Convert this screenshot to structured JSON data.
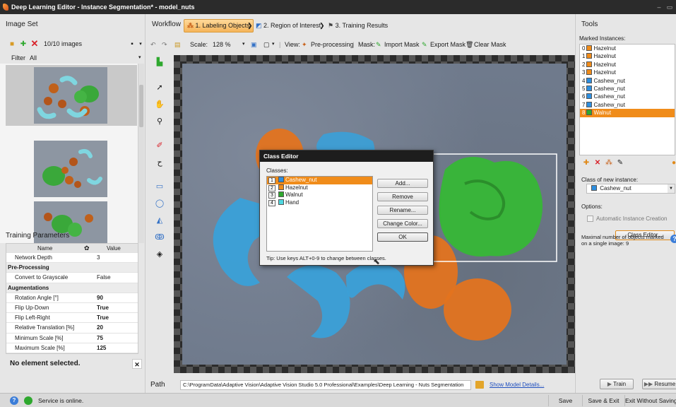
{
  "window": {
    "title": "Deep Learning Editor - Instance Segmentation* - model_nuts"
  },
  "image_set": {
    "header": "Image Set",
    "count_label": "10/10 images",
    "filter_label": "Filter",
    "filter_value": "All"
  },
  "training_params": {
    "header": "Training Parameters",
    "col_name": "Name",
    "col_value": "Value",
    "rows": [
      {
        "name": "Network Depth",
        "value": "3",
        "section": false,
        "bold": false
      },
      {
        "name": "Pre-Processing",
        "value": "",
        "section": true,
        "bold": false
      },
      {
        "name": "Convert to Grayscale",
        "value": "False",
        "section": false,
        "bold": false
      },
      {
        "name": "Augmentations",
        "value": "",
        "section": true,
        "bold": false
      },
      {
        "name": "Rotation Angle [°]",
        "value": "90",
        "section": false,
        "bold": true
      },
      {
        "name": "Flip Up-Down",
        "value": "True",
        "section": false,
        "bold": true
      },
      {
        "name": "Flip Left-Right",
        "value": "True",
        "section": false,
        "bold": true
      },
      {
        "name": "Relative Translation [%]",
        "value": "20",
        "section": false,
        "bold": true
      },
      {
        "name": "Minimum Scale [%]",
        "value": "75",
        "section": false,
        "bold": true
      },
      {
        "name": "Maximum Scale [%]",
        "value": "125",
        "section": false,
        "bold": true
      }
    ],
    "no_selection": "No element selected."
  },
  "workflow": {
    "header": "Workflow",
    "steps": [
      "1. Labeling Objects",
      "2. Region of Interest",
      "3. Training Results"
    ]
  },
  "toolbar": {
    "scale_label": "Scale:",
    "scale_value": "128 %",
    "view_label": "View:",
    "preprocessing": "Pre-processing",
    "mask_label": "Mask:",
    "import_mask": "Import Mask",
    "export_mask": "Export Mask",
    "clear_mask": "Clear Mask"
  },
  "path": {
    "label": "Path",
    "value": "C:\\ProgramData\\Adaptive Vision\\Adaptive Vision Studio 5.0 Professional\\Examples\\Deep Learning - Nuts Segmentation",
    "details_link": "Show Model Details..."
  },
  "tools": {
    "header": "Tools",
    "marked_label": "Marked Instances:",
    "instances": [
      {
        "idx": "0",
        "name": "Hazelnut",
        "color": "#f08c1a",
        "selected": false
      },
      {
        "idx": "1",
        "name": "Hazelnut",
        "color": "#f08c1a",
        "selected": false
      },
      {
        "idx": "2",
        "name": "Hazelnut",
        "color": "#f08c1a",
        "selected": false
      },
      {
        "idx": "3",
        "name": "Hazelnut",
        "color": "#f08c1a",
        "selected": false
      },
      {
        "idx": "4",
        "name": "Cashew_nut",
        "color": "#2e8fe0",
        "selected": false
      },
      {
        "idx": "5",
        "name": "Cashew_nut",
        "color": "#2e8fe0",
        "selected": false
      },
      {
        "idx": "6",
        "name": "Cashew_nut",
        "color": "#2e8fe0",
        "selected": false
      },
      {
        "idx": "7",
        "name": "Cashew_nut",
        "color": "#2e8fe0",
        "selected": false
      },
      {
        "idx": "8",
        "name": "Walnut",
        "color": "#2ea82e",
        "selected": true
      }
    ],
    "class_new_label": "Class of new instance:",
    "class_new_value": "Cashew_nut",
    "options_label": "Options:",
    "auto_creation": "Automatic Instance Creation",
    "class_editor_btn": "Class Editor...",
    "max_objects": "Maximal number of objects marked on a single image: 9"
  },
  "dialog": {
    "title": "Class Editor",
    "classes_label": "Classes:",
    "classes": [
      {
        "num": "1",
        "name": "Cashew_nut",
        "color": "#2e8fe0",
        "selected": true
      },
      {
        "num": "2",
        "name": "Hazelnut",
        "color": "#f08c1a",
        "selected": false
      },
      {
        "num": "3",
        "name": "Walnut",
        "color": "#2ea82e",
        "selected": false
      },
      {
        "num": "4",
        "name": "Hand",
        "color": "#4fd7e0",
        "selected": false
      }
    ],
    "add": "Add...",
    "remove": "Remove",
    "rename": "Rename...",
    "change_color": "Change Color...",
    "ok": "OK",
    "tip": "Tip: Use keys ALT+0-9 to change between classes."
  },
  "status": {
    "service": "Service is online.",
    "save": "Save",
    "save_exit": "Save & Exit",
    "exit_nosave": "Exit Without Saving"
  },
  "actions": {
    "train": "Train",
    "resume": "Resume"
  },
  "colors": {
    "accent": "#f08c1a",
    "cashew": "#2e8fe0",
    "hazelnut": "#f08c1a",
    "walnut": "#2ea82e",
    "hand": "#4fd7e0"
  }
}
